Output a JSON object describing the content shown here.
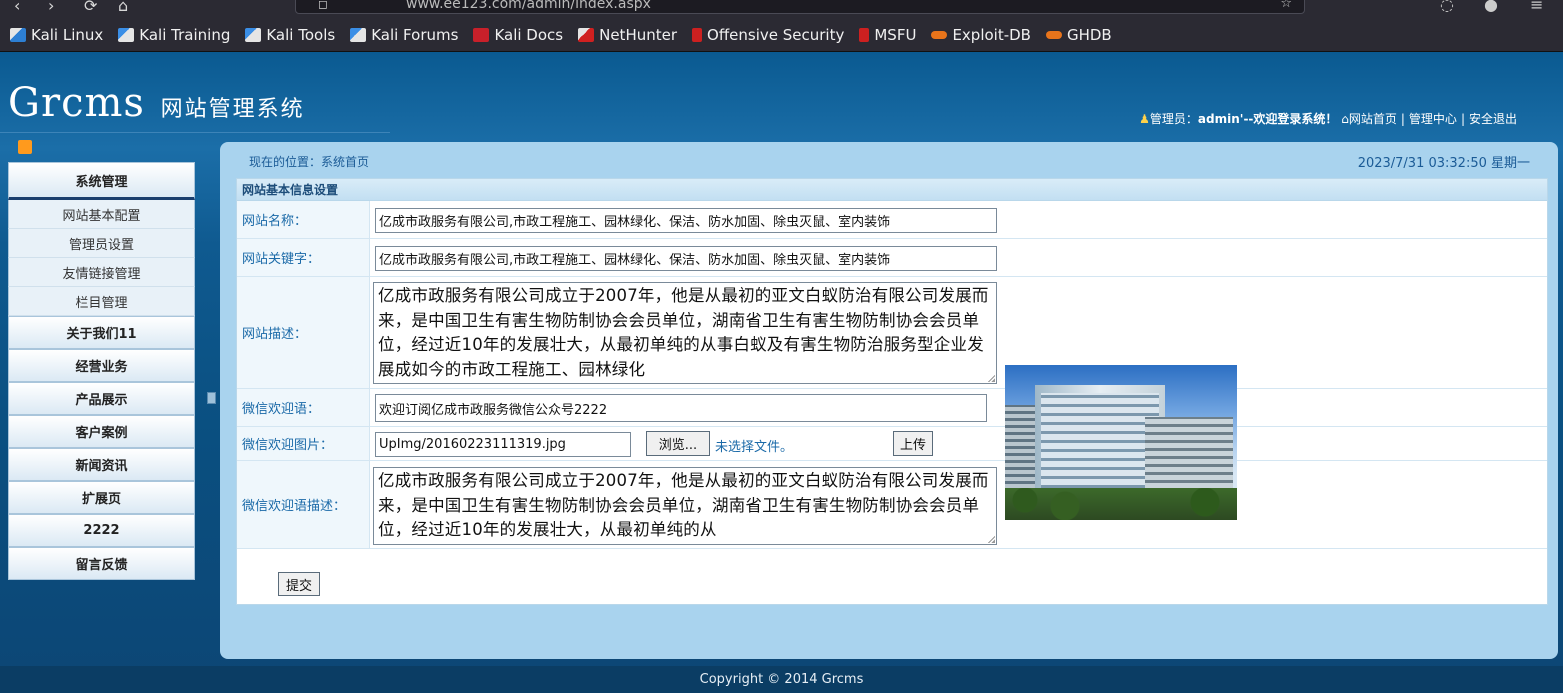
{
  "browser": {
    "url": "www.ee123.com/admin/index.aspx",
    "bookmarks": [
      {
        "label": "Kali Linux",
        "icon": "kali-dragon-icon"
      },
      {
        "label": "Kali Training",
        "icon": "kali-training-icon"
      },
      {
        "label": "Kali Tools",
        "icon": "kali-tools-icon"
      },
      {
        "label": "Kali Forums",
        "icon": "kali-forums-icon"
      },
      {
        "label": "Kali Docs",
        "icon": "kali-docs-icon"
      },
      {
        "label": "NetHunter",
        "icon": "nethunter-icon"
      },
      {
        "label": "Offensive Security",
        "icon": "offsec-icon"
      },
      {
        "label": "MSFU",
        "icon": "msfu-icon"
      },
      {
        "label": "Exploit-DB",
        "icon": "exploitdb-icon"
      },
      {
        "label": "GHDB",
        "icon": "ghdb-icon"
      }
    ]
  },
  "header": {
    "logo": "Grcms",
    "logo_sub": "网站管理系统",
    "admin_prefix": "管理员：",
    "admin_user": "admin'--欢迎登录系统！",
    "home_link": "网站首页",
    "admin_center": "管理中心",
    "logout": "安全退出",
    "separator": "|"
  },
  "sidebar": {
    "sections": [
      {
        "label": "系统管理",
        "items": [
          "网站基本配置",
          "管理员设置",
          "友情链接管理",
          "栏目管理"
        ]
      },
      {
        "label": "关于我们11"
      },
      {
        "label": "经营业务"
      },
      {
        "label": "产品展示"
      },
      {
        "label": "客户案例"
      },
      {
        "label": "新闻资讯"
      },
      {
        "label": "扩展页"
      },
      {
        "label": "2222"
      },
      {
        "label": "留言反馈"
      }
    ]
  },
  "main": {
    "breadcrumb": "现在的位置：系统首页",
    "datetime": "2023/7/31 03:32:50 星期一",
    "form_title": "网站基本信息设置",
    "fields": {
      "site_name_label": "网站名称：",
      "site_name_value": "亿成市政服务有限公司,市政工程施工、园林绿化、保洁、防水加固、除虫灭鼠、室内装饰",
      "keywords_label": "网站关键字：",
      "keywords_value": "亿成市政服务有限公司,市政工程施工、园林绿化、保洁、防水加固、除虫灭鼠、室内装饰",
      "desc_label": "网站描述：",
      "desc_value": "亿成市政服务有限公司成立于2007年，他是从最初的亚文白蚁防治有限公司发展而来，是中国卫生有害生物防制协会会员单位，湖南省卫生有害生物防制协会会员单位，经过近10年的发展壮大，从最初单纯的从事白蚁及有害生物防治服务型企业发展成如今的市政工程施工、园林绿化",
      "wechat_welcome_label": "微信欢迎语：",
      "wechat_welcome_value": "欢迎订阅亿成市政服务微信公众号2222",
      "wechat_image_label": "微信欢迎图片：",
      "wechat_image_value": "UpImg/20160223111319.jpg",
      "browse_label": "浏览...",
      "no_file_label": "未选择文件。",
      "upload_label": "上传",
      "wechat_desc_label": "微信欢迎语描述：",
      "wechat_desc_value": "亿成市政服务有限公司成立于2007年，他是从最初的亚文白蚁防治有限公司发展而来，是中国卫生有害生物防制协会会员单位，湖南省卫生有害生物防制协会会员单位，经过近10年的发展壮大，从最初单纯的从"
    },
    "submit_label": "提交"
  },
  "footer": {
    "copyright": "Copyright © 2014 Grcms"
  }
}
